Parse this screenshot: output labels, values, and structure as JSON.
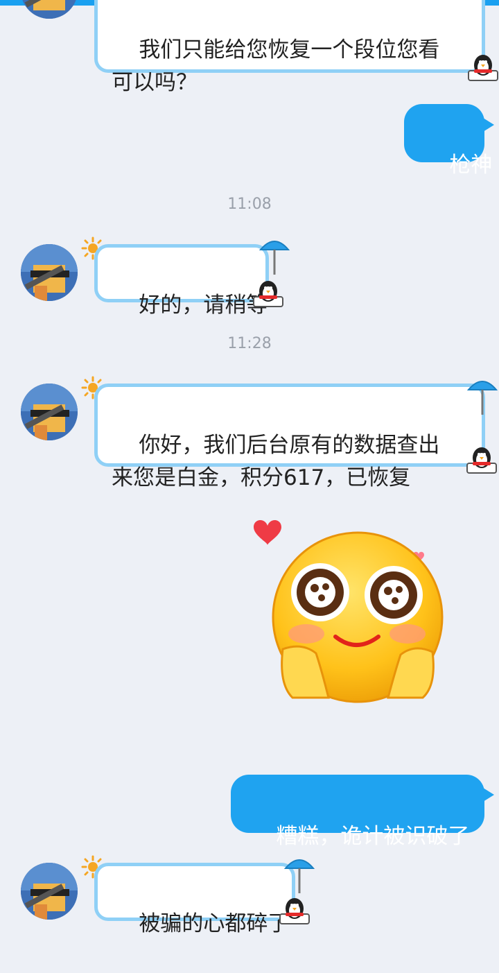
{
  "conversation": {
    "messages": [
      {
        "direction": "incoming",
        "text": "我们只能给您恢复一个段位您看\n可以吗？"
      },
      {
        "direction": "outgoing",
        "text": "枪神"
      },
      {
        "direction": "incoming",
        "text": "好的，请稍等"
      },
      {
        "direction": "incoming",
        "text": "你好，我们后台原有的数据查出\n来您是白金，积分617，已恢复"
      },
      {
        "direction": "outgoing",
        "text": "糟糕，诡计被识破了"
      },
      {
        "direction": "incoming",
        "text": "被骗的心都碎了"
      }
    ],
    "timestamps": [
      "11:08",
      "11:28"
    ]
  },
  "colors": {
    "background": "#edf0f6",
    "outgoing_bubble": "#1fa3f0",
    "incoming_border": "#8fd0f6",
    "timestamp_text": "#9aa0aa"
  },
  "icons": [
    "sun-icon",
    "umbrella-icon",
    "penguin-icon",
    "heart-icon",
    "smiling-face-sticker"
  ]
}
